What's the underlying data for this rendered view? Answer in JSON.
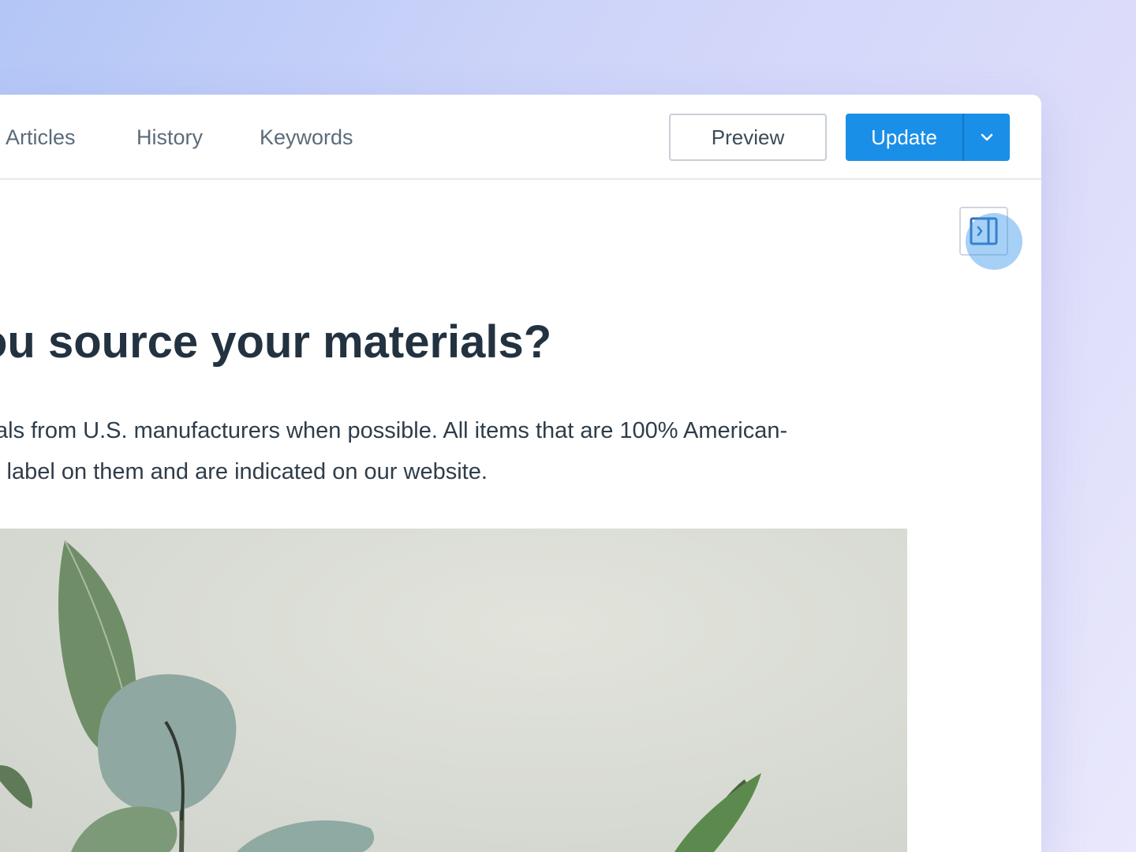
{
  "tabs": [
    {
      "label": "d Articles"
    },
    {
      "label": "History"
    },
    {
      "label": "Keywords"
    }
  ],
  "actions": {
    "preview_label": "Preview",
    "update_label": "Update"
  },
  "article": {
    "title": "ou source your materials?",
    "body_lines": [
      "als from U.S. manufacturers when possible. All items that are 100% American-",
      "l label on them and are indicated on our website."
    ]
  },
  "icons": {
    "update_menu": "chevron-down-icon",
    "sidebar_toggle": "sidebar-expand-icon"
  },
  "colors": {
    "accent": "#1a8fe8",
    "title_text": "#233240",
    "tab_text": "#5b6b7a"
  }
}
